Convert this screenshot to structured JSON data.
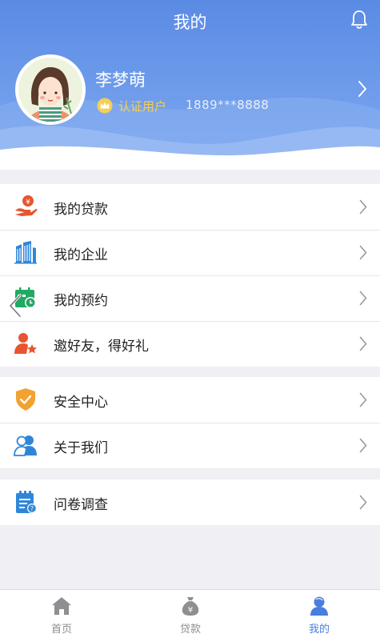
{
  "nav": {
    "title": "我的",
    "right_icon": "bell-icon"
  },
  "profile": {
    "name": "李梦萌",
    "badge_icon": "crown-icon",
    "certification": "认证用户",
    "phone": "1889***8888"
  },
  "menu_groups": [
    {
      "items": [
        {
          "label": "我的贷款",
          "icon": "loan-hand-icon"
        },
        {
          "label": "我的企业",
          "icon": "building-icon"
        },
        {
          "label": "我的预约",
          "icon": "calendar-clock-icon"
        },
        {
          "label": "邀好友，得好礼",
          "icon": "invite-user-star-icon"
        }
      ]
    },
    {
      "items": [
        {
          "label": "安全中心",
          "icon": "shield-check-icon"
        },
        {
          "label": "关于我们",
          "icon": "people-icon"
        }
      ]
    },
    {
      "items": [
        {
          "label": "问卷调查",
          "icon": "survey-clipboard-icon"
        }
      ]
    }
  ],
  "tabs": [
    {
      "label": "首页",
      "icon": "home-icon"
    },
    {
      "label": "贷款",
      "icon": "money-bag-icon"
    },
    {
      "label": "我的",
      "icon": "user-icon",
      "active": true
    }
  ],
  "colors": {
    "header_top": "#5a8be4",
    "accent": "#4a7de0",
    "gold": "#f6cf55",
    "orange_icon": "#e8542f",
    "blue_icon": "#2f86d9",
    "green_icon": "#22a964",
    "yellow_icon": "#f2a230"
  }
}
